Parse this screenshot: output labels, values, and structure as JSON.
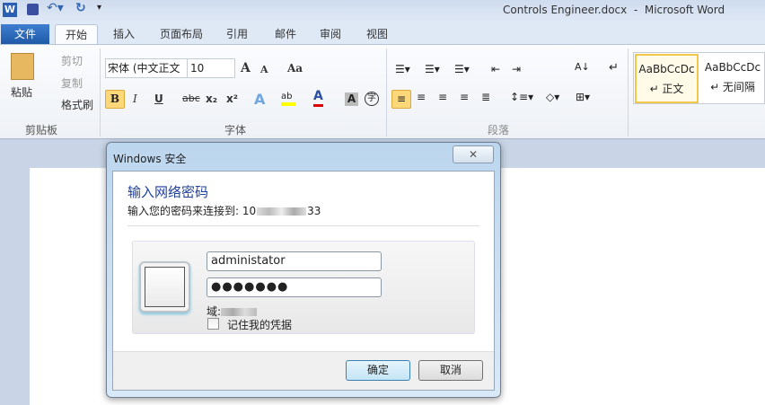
{
  "window": {
    "title": "Controls Engineer.docx  -  Microsoft Word"
  },
  "tabs": [
    "文件",
    "开始",
    "插入",
    "页面布局",
    "引用",
    "邮件",
    "审阅",
    "视图"
  ],
  "clipboard": {
    "paste": "粘贴",
    "cut": "剪切",
    "copy": "复制",
    "format_painter": "格式刷",
    "label": "剪贴板"
  },
  "font": {
    "name": "宋体 (中文正文",
    "size": "10",
    "label": "字体",
    "grow": "A",
    "shrink": "A",
    "case": "Aa",
    "bold": "B",
    "italic": "I",
    "underline": "U",
    "strike": "abc",
    "sub": "x₂",
    "sup": "x²",
    "color": "A"
  },
  "paragraph": {
    "label": "段落"
  },
  "styles": [
    {
      "preview": "AaBbCcDc",
      "name": "↵ 正文"
    },
    {
      "preview": "AaBbCcDc",
      "name": "↵ 无间隔"
    }
  ],
  "dialog": {
    "title": "Windows 安全",
    "heading": "输入网络密码",
    "subtext": "输入您的密码来连接到: 10",
    "subtext_end": "33",
    "username": "administator",
    "password": "●●●●●●●",
    "domain_label": "域:",
    "remember": "记住我的凭据",
    "ok": "确定",
    "cancel": "取消",
    "close": "✕"
  }
}
